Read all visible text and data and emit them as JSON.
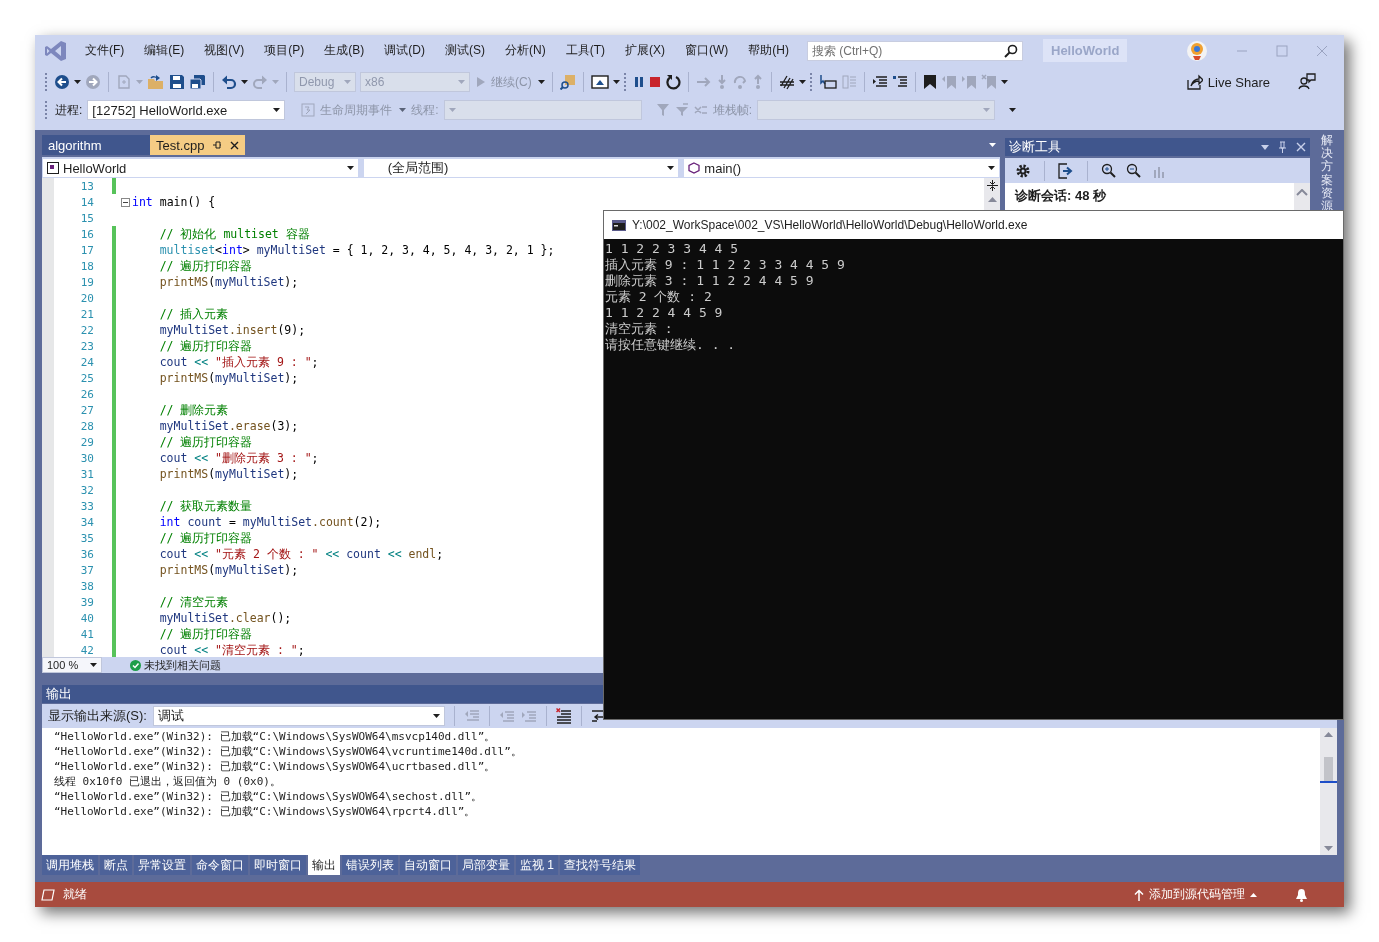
{
  "title_bar": {
    "menu": [
      "文件(F)",
      "编辑(E)",
      "视图(V)",
      "项目(P)",
      "生成(B)",
      "调试(D)",
      "测试(S)",
      "分析(N)",
      "工具(T)",
      "扩展(X)",
      "窗口(W)",
      "帮助(H)"
    ],
    "search": {
      "placeholder": "搜索 (Ctrl+Q)"
    },
    "solution_name": "HelloWorld"
  },
  "toolbar": {
    "configuration": {
      "text": "Debug",
      "disabled": true
    },
    "platform": {
      "text": "x86",
      "disabled": true
    },
    "continue": {
      "text": "继续(C)",
      "disabled": true
    },
    "live_share": "Live Share"
  },
  "debug_toolbar": {
    "process_label": "进程:",
    "process": "[12752] HelloWorld.exe",
    "lifecycle": {
      "text": "生命周期事件",
      "disabled": true
    },
    "thread_label": {
      "text": "线程:",
      "disabled": true
    },
    "stack_label": {
      "text": "堆栈帧:",
      "disabled": true
    }
  },
  "editor": {
    "tabs": [
      {
        "label": "algorithm",
        "selected": false
      },
      {
        "label": "Test.cpp",
        "selected": true
      }
    ],
    "nav": [
      "HelloWorld",
      "(全局范围)",
      "main()"
    ],
    "lines": [
      {
        "number": "13",
        "changed": true,
        "fold": false
      },
      {
        "number": "14",
        "changed": false,
        "fold": true,
        "code": [
          {
            "kind": "kw",
            "text": "int"
          },
          {
            "kind": "p",
            "text": " main() {"
          }
        ]
      },
      {
        "number": "15",
        "changed": false,
        "fold": false
      },
      {
        "number": "16",
        "changed": true,
        "fold": false,
        "code": [
          {
            "kind": "cm",
            "text": "    // 初始化 multiset 容器"
          }
        ]
      },
      {
        "number": "17",
        "changed": true,
        "fold": false,
        "code": [
          {
            "kind": "type",
            "text": "    multiset"
          },
          {
            "kind": "p",
            "text": "<"
          },
          {
            "kind": "kw",
            "text": "int"
          },
          {
            "kind": "p",
            "text": "> "
          },
          {
            "kind": "var",
            "text": "myMultiSet"
          },
          {
            "kind": "p",
            "text": " = { 1, 2, 3, 4, 5, 4, 3, 2, 1 };"
          }
        ]
      },
      {
        "number": "18",
        "changed": true,
        "fold": false,
        "code": [
          {
            "kind": "cm",
            "text": "    // 遍历打印容器"
          }
        ]
      },
      {
        "number": "19",
        "changed": true,
        "fold": false,
        "code": [
          {
            "kind": "fn",
            "text": "    printMS"
          },
          {
            "kind": "p",
            "text": "("
          },
          {
            "kind": "var",
            "text": "myMultiSet"
          },
          {
            "kind": "p",
            "text": ");"
          }
        ]
      },
      {
        "number": "20",
        "changed": true,
        "fold": false
      },
      {
        "number": "21",
        "changed": true,
        "fold": false,
        "code": [
          {
            "kind": "cm",
            "text": "    // 插入元素"
          }
        ]
      },
      {
        "number": "22",
        "changed": true,
        "fold": false,
        "code": [
          {
            "kind": "var",
            "text": "    myMultiSet"
          },
          {
            "kind": "fn",
            "text": ".insert"
          },
          {
            "kind": "p",
            "text": "(9);"
          }
        ]
      },
      {
        "number": "23",
        "changed": true,
        "fold": false,
        "code": [
          {
            "kind": "cm",
            "text": "    // 遍历打印容器"
          }
        ]
      },
      {
        "number": "24",
        "changed": true,
        "fold": false,
        "code": [
          {
            "kind": "var",
            "text": "    cout"
          },
          {
            "kind": "op",
            "text": " << "
          },
          {
            "kind": "str",
            "text": "\"插入元素 9 : \""
          },
          {
            "kind": "p",
            "text": ";"
          }
        ]
      },
      {
        "number": "25",
        "changed": true,
        "fold": false,
        "code": [
          {
            "kind": "fn",
            "text": "    printMS"
          },
          {
            "kind": "p",
            "text": "("
          },
          {
            "kind": "var",
            "text": "myMultiSet"
          },
          {
            "kind": "p",
            "text": ");"
          }
        ]
      },
      {
        "number": "26",
        "changed": true,
        "fold": false
      },
      {
        "number": "27",
        "changed": true,
        "fold": false,
        "code": [
          {
            "kind": "cm",
            "text": "    // 删除元素"
          }
        ]
      },
      {
        "number": "28",
        "changed": true,
        "fold": false,
        "code": [
          {
            "kind": "var",
            "text": "    myMultiSet"
          },
          {
            "kind": "fn",
            "text": ".erase"
          },
          {
            "kind": "p",
            "text": "(3);"
          }
        ]
      },
      {
        "number": "29",
        "changed": true,
        "fold": false,
        "code": [
          {
            "kind": "cm",
            "text": "    // 遍历打印容器"
          }
        ]
      },
      {
        "number": "30",
        "changed": true,
        "fold": false,
        "code": [
          {
            "kind": "var",
            "text": "    cout"
          },
          {
            "kind": "op",
            "text": " << "
          },
          {
            "kind": "str",
            "text": "\"删除元素 3 : \""
          },
          {
            "kind": "p",
            "text": ";"
          }
        ]
      },
      {
        "number": "31",
        "changed": true,
        "fold": false,
        "code": [
          {
            "kind": "fn",
            "text": "    printMS"
          },
          {
            "kind": "p",
            "text": "("
          },
          {
            "kind": "var",
            "text": "myMultiSet"
          },
          {
            "kind": "p",
            "text": ");"
          }
        ]
      },
      {
        "number": "32",
        "changed": true,
        "fold": false
      },
      {
        "number": "33",
        "changed": true,
        "fold": false,
        "code": [
          {
            "kind": "cm",
            "text": "    // 获取元素数量"
          }
        ]
      },
      {
        "number": "34",
        "changed": true,
        "fold": false,
        "code": [
          {
            "kind": "kw",
            "text": "    int"
          },
          {
            "kind": "var",
            "text": " count"
          },
          {
            "kind": "p",
            "text": " = "
          },
          {
            "kind": "var",
            "text": "myMultiSet"
          },
          {
            "kind": "fn",
            "text": ".count"
          },
          {
            "kind": "p",
            "text": "(2);"
          }
        ]
      },
      {
        "number": "35",
        "changed": true,
        "fold": false,
        "code": [
          {
            "kind": "cm",
            "text": "    // 遍历打印容器"
          }
        ]
      },
      {
        "number": "36",
        "changed": true,
        "fold": false,
        "code": [
          {
            "kind": "var",
            "text": "    cout"
          },
          {
            "kind": "op",
            "text": " << "
          },
          {
            "kind": "str",
            "text": "\"元素 2 个数 : \""
          },
          {
            "kind": "op",
            "text": " << "
          },
          {
            "kind": "var",
            "text": "count"
          },
          {
            "kind": "op",
            "text": " << "
          },
          {
            "kind": "fn",
            "text": "endl"
          },
          {
            "kind": "p",
            "text": ";"
          }
        ]
      },
      {
        "number": "37",
        "changed": true,
        "fold": false,
        "code": [
          {
            "kind": "fn",
            "text": "    printMS"
          },
          {
            "kind": "p",
            "text": "("
          },
          {
            "kind": "var",
            "text": "myMultiSet"
          },
          {
            "kind": "p",
            "text": ");"
          }
        ]
      },
      {
        "number": "38",
        "changed": true,
        "fold": false
      },
      {
        "number": "39",
        "changed": true,
        "fold": false,
        "code": [
          {
            "kind": "cm",
            "text": "    // 清空元素"
          }
        ]
      },
      {
        "number": "40",
        "changed": true,
        "fold": false,
        "code": [
          {
            "kind": "var",
            "text": "    myMultiSet"
          },
          {
            "kind": "fn",
            "text": ".clear"
          },
          {
            "kind": "p",
            "text": "();"
          }
        ]
      },
      {
        "number": "41",
        "changed": true,
        "fold": false,
        "code": [
          {
            "kind": "cm",
            "text": "    // 遍历打印容器"
          }
        ]
      },
      {
        "number": "42",
        "changed": true,
        "fold": false,
        "code": [
          {
            "kind": "var",
            "text": "    cout"
          },
          {
            "kind": "op",
            "text": " << "
          },
          {
            "kind": "str",
            "text": "\"清空元素 : \""
          },
          {
            "kind": "p",
            "text": ";"
          }
        ]
      }
    ],
    "zoom": "100 %",
    "issues": "未找到相关问题"
  },
  "diagnostics": {
    "title": "诊断工具",
    "session": "诊断会话: 48 秒"
  },
  "side_tab": "解决方案资源",
  "output": {
    "title": "输出",
    "source_label": "显示输出来源(S):",
    "source": "调试",
    "lines": [
      "“HelloWorld.exe”(Win32): 已加载“C:\\Windows\\SysWOW64\\msvcp140d.dll”。",
      "“HelloWorld.exe”(Win32): 已加载“C:\\Windows\\SysWOW64\\vcruntime140d.dll”。",
      "“HelloWorld.exe”(Win32): 已加载“C:\\Windows\\SysWOW64\\ucrtbased.dll”。",
      "线程 0x10f0 已退出，返回值为 0 (0x0)。",
      "“HelloWorld.exe”(Win32): 已加载“C:\\Windows\\SysWOW64\\sechost.dll”。",
      "“HelloWorld.exe”(Win32): 已加载“C:\\Windows\\SysWOW64\\rpcrt4.dll”。"
    ]
  },
  "bottom_tabs": [
    {
      "label": "调用堆栈",
      "selected": false
    },
    {
      "label": "断点",
      "selected": false
    },
    {
      "label": "异常设置",
      "selected": false
    },
    {
      "label": "命令窗口",
      "selected": false
    },
    {
      "label": "即时窗口",
      "selected": false
    },
    {
      "label": "输出",
      "selected": true
    },
    {
      "label": "错误列表",
      "selected": false
    },
    {
      "label": "自动窗口",
      "selected": false
    },
    {
      "label": "局部变量",
      "selected": false
    },
    {
      "label": "监视 1",
      "selected": false
    },
    {
      "label": "查找符号结果",
      "selected": false
    }
  ],
  "status_bar": {
    "text": "就绪",
    "source_control": "添加到源代码管理"
  },
  "console": {
    "title": "Y:\\002_WorkSpace\\002_VS\\HelloWorld\\HelloWorld\\Debug\\HelloWorld.exe",
    "lines": [
      "1 1 2 2 3 3 4 4 5",
      "插入元素 9 : 1 1 2 2 3 3 4 4 5 9",
      "删除元素 3 : 1 1 2 2 4 4 5 9",
      "元素 2 个数 : 2",
      "1 1 2 2 4 4 5 9",
      "清空元素 :",
      "请按任意键继续. . ."
    ]
  }
}
